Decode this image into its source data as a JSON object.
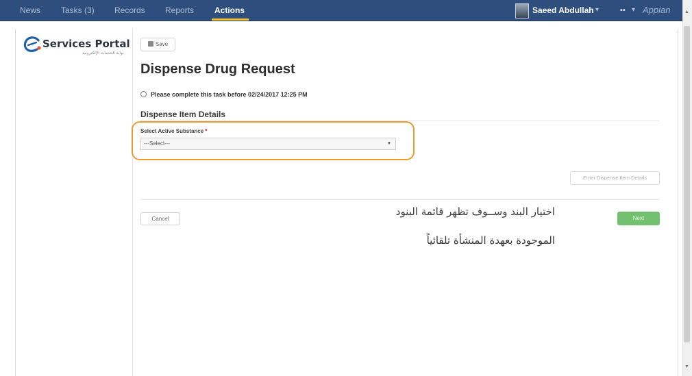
{
  "topnav": {
    "items": [
      {
        "label": "News"
      },
      {
        "label": "Tasks (3)"
      },
      {
        "label": "Records"
      },
      {
        "label": "Reports"
      },
      {
        "label": "Actions"
      }
    ],
    "user_name": "Saeed Abdullah",
    "user_chevron": "▾",
    "apps_icon": "▪▪",
    "apps_chevron": "▾",
    "brand": "Appian"
  },
  "logo": {
    "text": "Services Portal",
    "subtitle": "بوابة الخدمات الإلكترونية",
    "icon": "e-logo-icon"
  },
  "toolbar": {
    "save_label": "Save",
    "save_icon": "floppy-disk-icon"
  },
  "form": {
    "title": "Dispense Drug Request",
    "deadline": "Please complete this task before 02/24/2017 12:25 PM",
    "section_heading": "Dispense Item Details",
    "field_label": "Select Active Substance",
    "required_mark": "*",
    "select_value": "---Select---",
    "details_button": "Enter Dispense Item Details",
    "cancel_button": "Cancel",
    "next_button": "Next"
  },
  "annotation": {
    "line1": "اختيار البند وســوف تظهر قائمة البنود",
    "line2": "الموجودة بعهدة المنشأة تلقائياً"
  },
  "colors": {
    "nav_bg": "#2e4f7e",
    "nav_active_underline": "#f2c230",
    "highlight": "#ee9b2a",
    "next_button": "#71c171",
    "required": "#d0021b"
  }
}
